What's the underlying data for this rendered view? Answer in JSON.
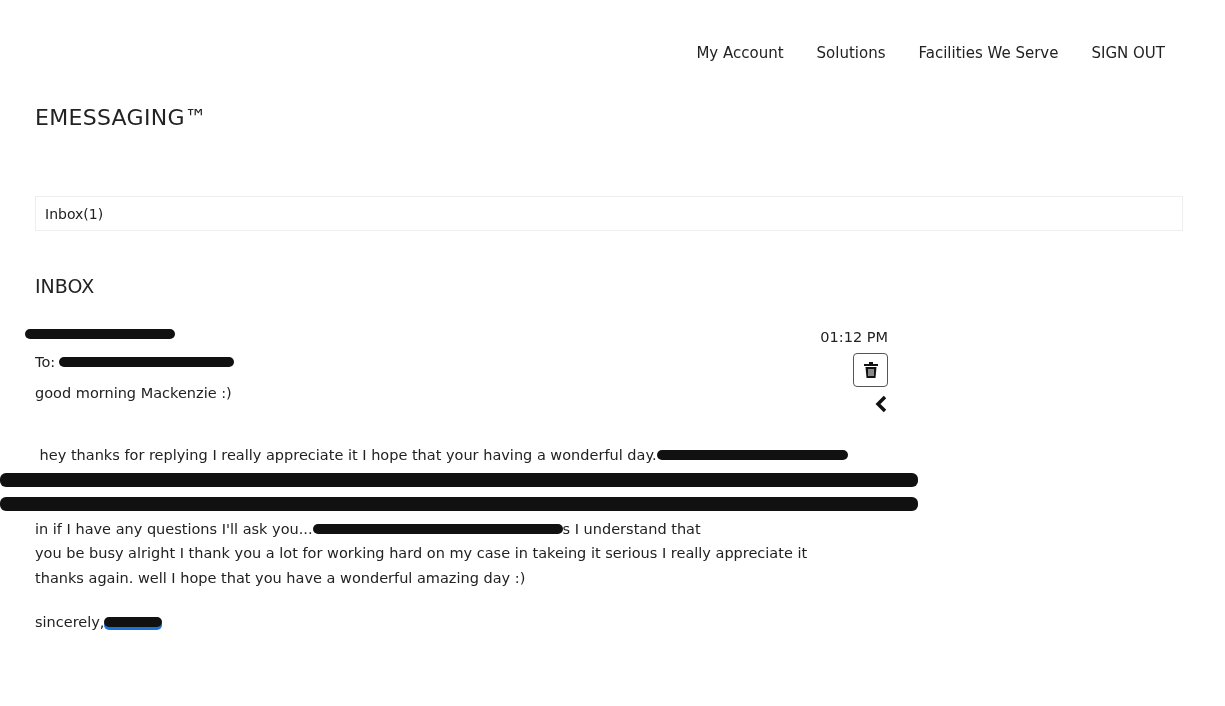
{
  "nav": {
    "links": [
      "My Account",
      "Solutions",
      "Facilities We Serve",
      "SIGN OUT"
    ]
  },
  "brand": {
    "title": "EMESSAGING™"
  },
  "folders": [
    {
      "label": "Inbox(1)",
      "selected": true
    }
  ],
  "section_title": "INBOX",
  "message": {
    "time": "01:12 PM",
    "to_label": "To:",
    "greeting": "good morning Mackenzie :)",
    "body": [
      {
        "segments": [
          {
            "kind": "text",
            "text": " hey thanks for replying I really appreciate it I hope that your having a wonderful day."
          },
          {
            "kind": "redacted"
          }
        ]
      },
      {
        "segments": [
          {
            "kind": "redacted"
          }
        ]
      },
      {
        "segments": [
          {
            "kind": "redacted"
          }
        ]
      },
      {
        "segments": [
          {
            "kind": "text",
            "text": "in if I have any questions I'll ask you..."
          },
          {
            "kind": "redacted"
          },
          {
            "kind": "text",
            "text": "s I understand that"
          }
        ]
      },
      {
        "segments": [
          {
            "kind": "text",
            "text": "you be busy alright I thank you a lot for working hard on my case in takeing it serious I really appreciate it"
          }
        ]
      },
      {
        "segments": [
          {
            "kind": "text",
            "text": "thanks again. well I hope that you have a wonderful amazing day :)"
          }
        ]
      }
    ],
    "signoff": "sincerely,"
  }
}
